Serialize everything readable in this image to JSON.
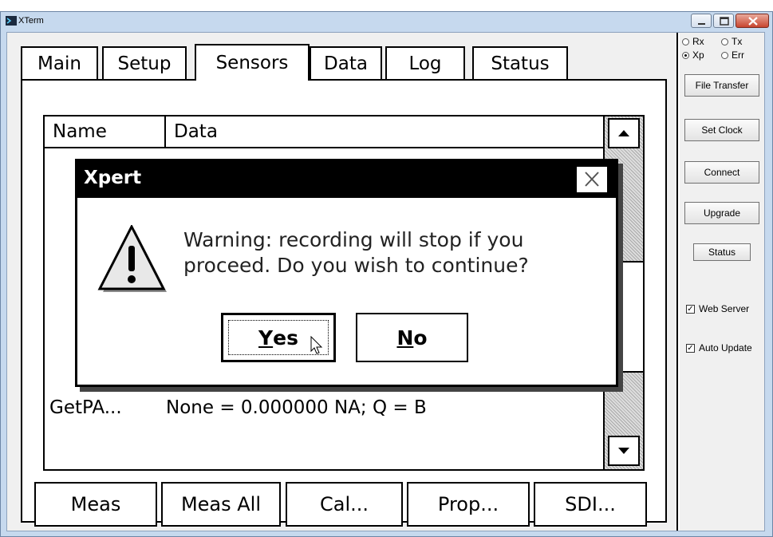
{
  "window": {
    "title": "XTerm"
  },
  "tabs": [
    "Main",
    "Setup",
    "Sensors",
    "Data",
    "Log",
    "Status"
  ],
  "list": {
    "headers": [
      "Name",
      "Data"
    ],
    "rows": [
      {
        "name": "GetPA...",
        "data": "None = 0.000000 NA; Q = B"
      }
    ]
  },
  "bottom_buttons": [
    "Meas",
    "Meas All",
    "Cal...",
    "Prop...",
    "SDI..."
  ],
  "dialog": {
    "title": "Xpert",
    "message_line1": "Warning: recording will stop if you",
    "message_line2": "proceed. Do you wish to continue?",
    "yes_accel": "Y",
    "yes_rest": "es",
    "no_accel": "N",
    "no_rest": "o"
  },
  "side": {
    "radios": [
      {
        "label": "Rx",
        "checked": false
      },
      {
        "label": "Tx",
        "checked": false
      },
      {
        "label": "Xp",
        "checked": true
      },
      {
        "label": "Err",
        "checked": false
      }
    ],
    "buttons": [
      "File Transfer",
      "Set Clock",
      "Connect",
      "Upgrade",
      "Status"
    ],
    "checks": [
      {
        "label": "Web Server",
        "checked": true
      },
      {
        "label": "Auto Update",
        "checked": true
      }
    ]
  }
}
